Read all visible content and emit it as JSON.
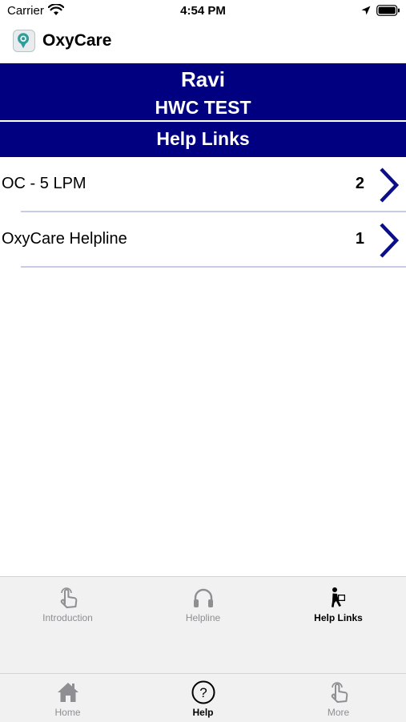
{
  "status_bar": {
    "carrier": "Carrier",
    "time": "4:54 PM"
  },
  "app": {
    "title": "OxyCare"
  },
  "header": {
    "name": "Ravi",
    "org": "HWC TEST",
    "section": "Help Links"
  },
  "list": {
    "items": [
      {
        "label": "OC - 5 LPM",
        "count": "2"
      },
      {
        "label": "OxyCare Helpline",
        "count": "1"
      }
    ]
  },
  "sub_tabs": {
    "items": [
      {
        "label": "Introduction",
        "icon": "hand-pointer-icon"
      },
      {
        "label": "Helpline",
        "icon": "headphones-icon"
      },
      {
        "label": "Help Links",
        "icon": "person-carrying-box-icon"
      }
    ],
    "active": "Help Links"
  },
  "main_tabs": {
    "items": [
      {
        "label": "Home",
        "icon": "home-icon"
      },
      {
        "label": "Help",
        "icon": "question-circle-icon"
      },
      {
        "label": "More",
        "icon": "hand-pointer-icon"
      }
    ],
    "active": "Help"
  },
  "colors": {
    "header_bg": "#010080",
    "chevron": "#0c0f8a",
    "separator": "#c8cbe6",
    "tabbar_bg": "#f1f1f1"
  }
}
